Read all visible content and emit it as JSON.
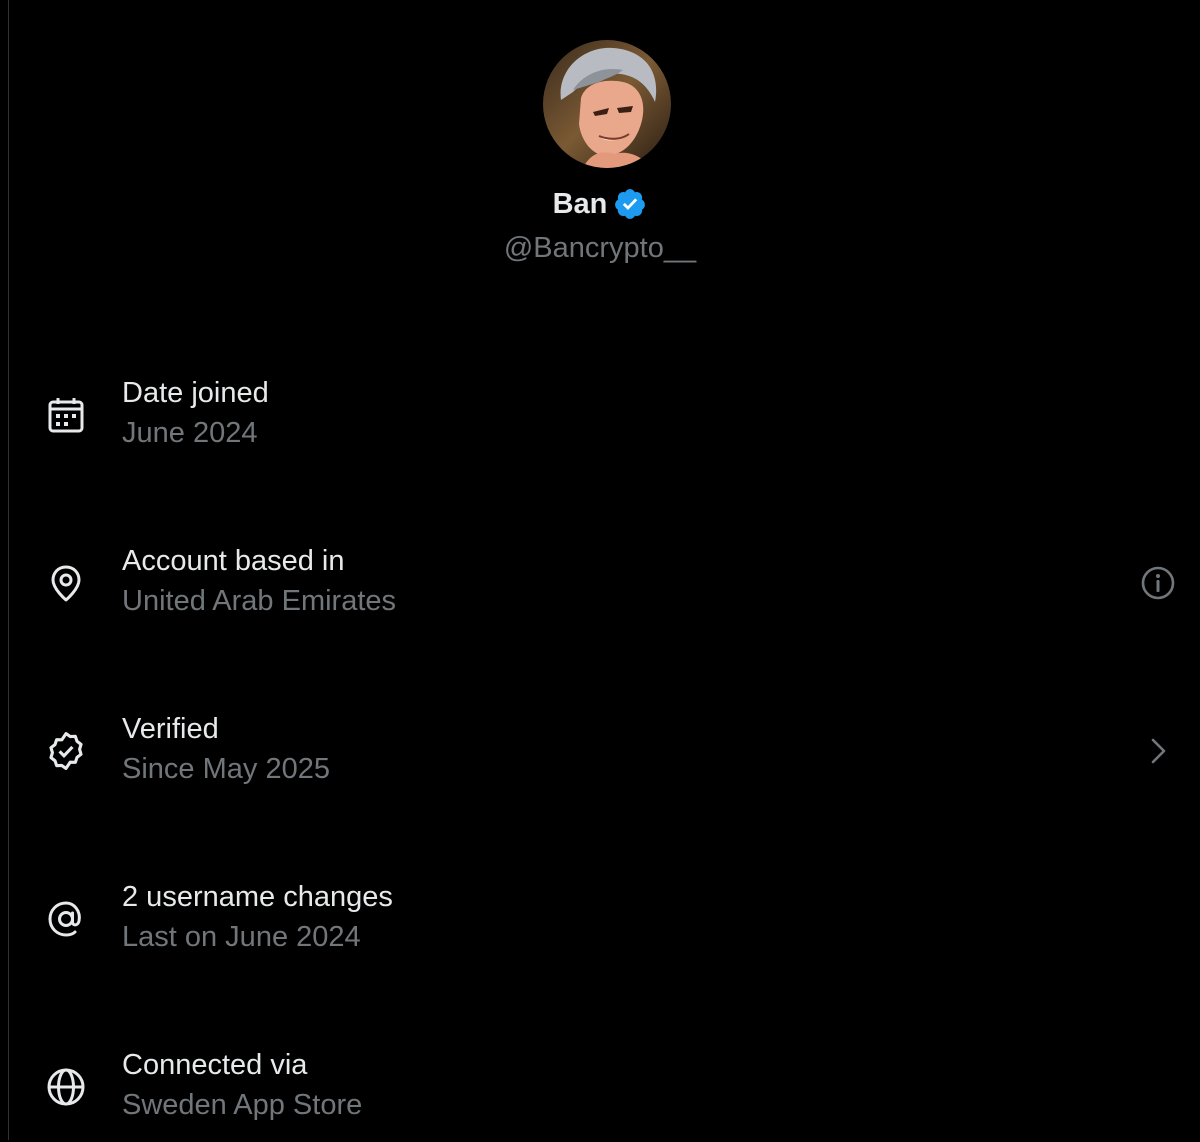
{
  "profile": {
    "display_name": "Ban",
    "handle": "@Bancrypto__",
    "verified_color": "#1d9bf0"
  },
  "rows": [
    {
      "title": "Date joined",
      "subtitle": "June 2024",
      "icon": "calendar-icon"
    },
    {
      "title": "Account based in",
      "subtitle": "United Arab Emirates",
      "icon": "location-pin-icon",
      "trailing": "info-icon"
    },
    {
      "title": "Verified",
      "subtitle": "Since May 2025",
      "icon": "verified-badge-outline-icon",
      "trailing": "chevron-right-icon"
    },
    {
      "title": "2 username changes",
      "subtitle": "Last on June 2024",
      "icon": "at-sign-icon"
    },
    {
      "title": "Connected via",
      "subtitle": "Sweden App Store",
      "icon": "globe-icon"
    }
  ],
  "colors": {
    "background": "#000000",
    "primary_text": "#e7e9ea",
    "secondary_text": "#71767b",
    "accent": "#1d9bf0"
  }
}
